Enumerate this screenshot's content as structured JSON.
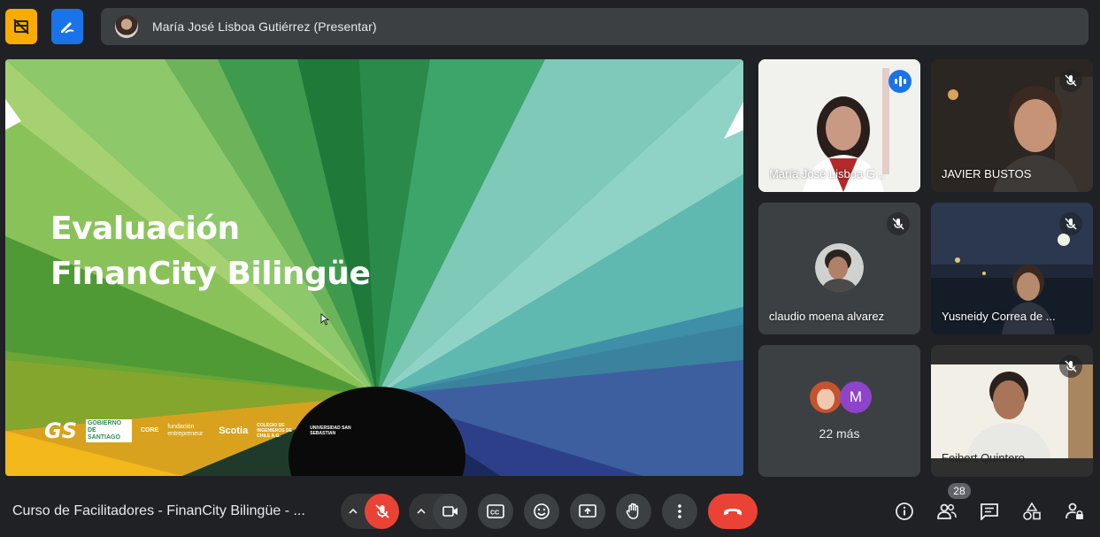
{
  "presenter": {
    "name": "María José Lisboa Gutiérrez (Presentar)"
  },
  "slide": {
    "title_line1": "Evaluación",
    "title_line2": "FinanCity Bilingüe",
    "logos": {
      "gs": "GS",
      "gobierno": "GOBIERNO DE SANTIAGO",
      "core": "CORE",
      "fundacion": "fundación entrepreneur",
      "scotia": "Scotia",
      "colegio": "COLEGIO DE INGENIEROS DE CHILE A.G.",
      "universidad": "UNIVERSIDAD SAN SEBASTIAN"
    }
  },
  "participants": [
    {
      "name": "María José Lisboa G...",
      "state": "speaking"
    },
    {
      "name": "JAVIER BUSTOS",
      "state": "muted"
    },
    {
      "name": "claudio moena alvarez",
      "state": "muted"
    },
    {
      "name": "Yusneidy Correa de ...",
      "state": "muted"
    },
    {
      "name": "Feibert Quintero",
      "state": "muted"
    }
  ],
  "more_tile": {
    "initial": "M",
    "label": "22 más"
  },
  "meeting": {
    "title": "Curso de Facilitadores - FinanCity Bilingüe - ...",
    "participant_count": "28"
  },
  "controls": [
    {
      "name": "mic",
      "state": "off"
    },
    {
      "name": "camera",
      "state": "on"
    },
    {
      "name": "captions"
    },
    {
      "name": "reactions"
    },
    {
      "name": "present"
    },
    {
      "name": "raise-hand"
    },
    {
      "name": "more-options"
    },
    {
      "name": "leave-call"
    }
  ],
  "colors": {
    "background": "#202124",
    "tile": "#3c4043",
    "danger": "#ea4335",
    "accent": "#1a73e8",
    "active_outline": "#8ab4f8"
  }
}
